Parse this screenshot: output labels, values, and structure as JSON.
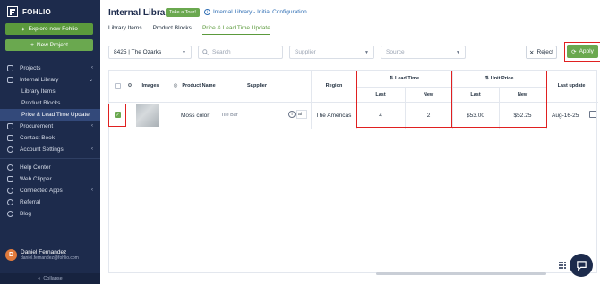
{
  "brand": {
    "name": "FOHLIO"
  },
  "sidebar": {
    "explore_label": "Explore new Fohlio",
    "new_project_label": "New Project",
    "items": [
      {
        "label": "Projects",
        "chevron": "‹"
      },
      {
        "label": "Internal Library",
        "chevron": "⌄"
      },
      {
        "label": "Procurement",
        "chevron": "‹"
      },
      {
        "label": "Contact Book"
      },
      {
        "label": "Account Settings",
        "chevron": "‹"
      },
      {
        "label": "Help Center"
      },
      {
        "label": "Web Clipper"
      },
      {
        "label": "Connected Apps",
        "chevron": "‹"
      },
      {
        "label": "Referral"
      },
      {
        "label": "Blog"
      }
    ],
    "sub_items": [
      {
        "label": "Library Items"
      },
      {
        "label": "Product Blocks"
      },
      {
        "label": "Price & Lead Time Update"
      }
    ],
    "user": {
      "initial": "D",
      "name": "Daniel Fernandez",
      "email": "daniel.fernandez@fohlio.com"
    },
    "collapse_label": "Collapse"
  },
  "header": {
    "title": "Internal Library",
    "tour_label": "Take a Tour!",
    "config_link": "Internal Library - Initial Configuration"
  },
  "tabs": [
    {
      "label": "Library Items"
    },
    {
      "label": "Product Blocks"
    },
    {
      "label": "Price & Lead Time Update"
    }
  ],
  "toolbar": {
    "project_select": "8425 | The Ozarks",
    "search_placeholder": "Search",
    "supplier_placeholder": "Supplier",
    "source_placeholder": "Source",
    "reject_label": "Reject",
    "apply_label": "Apply"
  },
  "table": {
    "headers": {
      "images": "Images",
      "product_name": "Product Name",
      "supplier": "Supplier",
      "region": "Region",
      "lead_time": "Lead Time",
      "unit_price": "Unit Price",
      "last": "Last",
      "new": "New",
      "last_update": "Last update"
    },
    "rows": [
      {
        "product_name": "Moss color",
        "supplier": "Tile Bar",
        "supplier_suffix": "ai",
        "region": "The Americas",
        "lead_last": "4",
        "lead_new": "2",
        "price_last": "$53.00",
        "price_new": "$52.25",
        "last_update": "Aug-16-25",
        "checked": true
      }
    ]
  },
  "colors": {
    "sidebar": "#1d2b4c",
    "accent_green": "#6aa84f",
    "highlight_red": "#e02020",
    "link_blue": "#2c6cb3"
  }
}
